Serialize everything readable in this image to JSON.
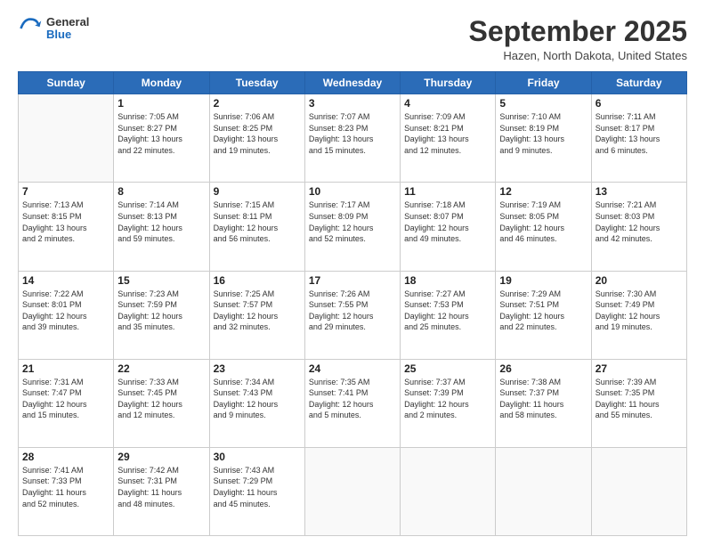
{
  "header": {
    "logo_general": "General",
    "logo_blue": "Blue",
    "month_title": "September 2025",
    "location": "Hazen, North Dakota, United States"
  },
  "days_of_week": [
    "Sunday",
    "Monday",
    "Tuesday",
    "Wednesday",
    "Thursday",
    "Friday",
    "Saturday"
  ],
  "weeks": [
    [
      {
        "day": "",
        "info": ""
      },
      {
        "day": "1",
        "info": "Sunrise: 7:05 AM\nSunset: 8:27 PM\nDaylight: 13 hours\nand 22 minutes."
      },
      {
        "day": "2",
        "info": "Sunrise: 7:06 AM\nSunset: 8:25 PM\nDaylight: 13 hours\nand 19 minutes."
      },
      {
        "day": "3",
        "info": "Sunrise: 7:07 AM\nSunset: 8:23 PM\nDaylight: 13 hours\nand 15 minutes."
      },
      {
        "day": "4",
        "info": "Sunrise: 7:09 AM\nSunset: 8:21 PM\nDaylight: 13 hours\nand 12 minutes."
      },
      {
        "day": "5",
        "info": "Sunrise: 7:10 AM\nSunset: 8:19 PM\nDaylight: 13 hours\nand 9 minutes."
      },
      {
        "day": "6",
        "info": "Sunrise: 7:11 AM\nSunset: 8:17 PM\nDaylight: 13 hours\nand 6 minutes."
      }
    ],
    [
      {
        "day": "7",
        "info": "Sunrise: 7:13 AM\nSunset: 8:15 PM\nDaylight: 13 hours\nand 2 minutes."
      },
      {
        "day": "8",
        "info": "Sunrise: 7:14 AM\nSunset: 8:13 PM\nDaylight: 12 hours\nand 59 minutes."
      },
      {
        "day": "9",
        "info": "Sunrise: 7:15 AM\nSunset: 8:11 PM\nDaylight: 12 hours\nand 56 minutes."
      },
      {
        "day": "10",
        "info": "Sunrise: 7:17 AM\nSunset: 8:09 PM\nDaylight: 12 hours\nand 52 minutes."
      },
      {
        "day": "11",
        "info": "Sunrise: 7:18 AM\nSunset: 8:07 PM\nDaylight: 12 hours\nand 49 minutes."
      },
      {
        "day": "12",
        "info": "Sunrise: 7:19 AM\nSunset: 8:05 PM\nDaylight: 12 hours\nand 46 minutes."
      },
      {
        "day": "13",
        "info": "Sunrise: 7:21 AM\nSunset: 8:03 PM\nDaylight: 12 hours\nand 42 minutes."
      }
    ],
    [
      {
        "day": "14",
        "info": "Sunrise: 7:22 AM\nSunset: 8:01 PM\nDaylight: 12 hours\nand 39 minutes."
      },
      {
        "day": "15",
        "info": "Sunrise: 7:23 AM\nSunset: 7:59 PM\nDaylight: 12 hours\nand 35 minutes."
      },
      {
        "day": "16",
        "info": "Sunrise: 7:25 AM\nSunset: 7:57 PM\nDaylight: 12 hours\nand 32 minutes."
      },
      {
        "day": "17",
        "info": "Sunrise: 7:26 AM\nSunset: 7:55 PM\nDaylight: 12 hours\nand 29 minutes."
      },
      {
        "day": "18",
        "info": "Sunrise: 7:27 AM\nSunset: 7:53 PM\nDaylight: 12 hours\nand 25 minutes."
      },
      {
        "day": "19",
        "info": "Sunrise: 7:29 AM\nSunset: 7:51 PM\nDaylight: 12 hours\nand 22 minutes."
      },
      {
        "day": "20",
        "info": "Sunrise: 7:30 AM\nSunset: 7:49 PM\nDaylight: 12 hours\nand 19 minutes."
      }
    ],
    [
      {
        "day": "21",
        "info": "Sunrise: 7:31 AM\nSunset: 7:47 PM\nDaylight: 12 hours\nand 15 minutes."
      },
      {
        "day": "22",
        "info": "Sunrise: 7:33 AM\nSunset: 7:45 PM\nDaylight: 12 hours\nand 12 minutes."
      },
      {
        "day": "23",
        "info": "Sunrise: 7:34 AM\nSunset: 7:43 PM\nDaylight: 12 hours\nand 9 minutes."
      },
      {
        "day": "24",
        "info": "Sunrise: 7:35 AM\nSunset: 7:41 PM\nDaylight: 12 hours\nand 5 minutes."
      },
      {
        "day": "25",
        "info": "Sunrise: 7:37 AM\nSunset: 7:39 PM\nDaylight: 12 hours\nand 2 minutes."
      },
      {
        "day": "26",
        "info": "Sunrise: 7:38 AM\nSunset: 7:37 PM\nDaylight: 11 hours\nand 58 minutes."
      },
      {
        "day": "27",
        "info": "Sunrise: 7:39 AM\nSunset: 7:35 PM\nDaylight: 11 hours\nand 55 minutes."
      }
    ],
    [
      {
        "day": "28",
        "info": "Sunrise: 7:41 AM\nSunset: 7:33 PM\nDaylight: 11 hours\nand 52 minutes."
      },
      {
        "day": "29",
        "info": "Sunrise: 7:42 AM\nSunset: 7:31 PM\nDaylight: 11 hours\nand 48 minutes."
      },
      {
        "day": "30",
        "info": "Sunrise: 7:43 AM\nSunset: 7:29 PM\nDaylight: 11 hours\nand 45 minutes."
      },
      {
        "day": "",
        "info": ""
      },
      {
        "day": "",
        "info": ""
      },
      {
        "day": "",
        "info": ""
      },
      {
        "day": "",
        "info": ""
      }
    ]
  ]
}
